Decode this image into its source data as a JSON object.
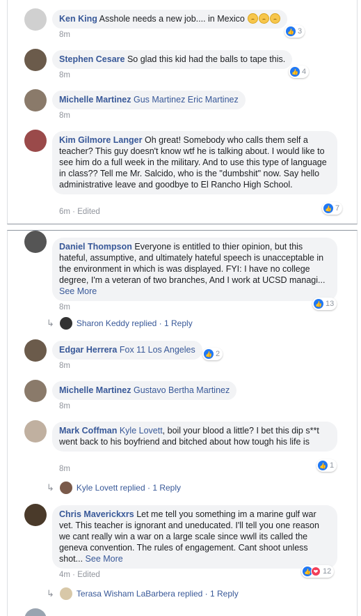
{
  "top_comments": [
    {
      "author": "Ken King",
      "text": "Asshole needs a new job.... in Mexico",
      "time": "8m",
      "reactions": "3",
      "emoji_icon": "tired-face-emoji",
      "avatar_color": "#c8c8c8"
    },
    {
      "author": "Stephen Cesare",
      "text": "So glad this kid had the balls to tape this.",
      "time": "8m",
      "reactions": "4",
      "avatar_color": "#5a4a3a"
    },
    {
      "author": "Michelle Martinez",
      "tags": "Gus Martinez Eric Martinez",
      "time": "8m",
      "avatar_color": "#7a6a5a"
    },
    {
      "author": "Kim Gilmore Langer",
      "text": "Oh great! Somebody who calls them self a teacher? This guy doesn't know wtf he is talking about. I would like to see him do a full week in the military. And to use this type of language in class?? Tell me Mr. Salcido, who is the \"dumbshit\" now. Say hello administrative leave and goodbye to El Rancho High School.",
      "time": "6m · Edited",
      "reactions": "7",
      "avatar_color": "#8a3a3a"
    }
  ],
  "bottom_comments": [
    {
      "author": "Daniel Thompson",
      "text": "Everyone is entitled to thier opinion, but this hateful, assumptive, and ultimately hateful speech is unacceptable in the environment in which is was displayed. FYI: I have no college degree, I'm a veteran of two branches, And I work at UCSD managi...",
      "see_more": "See More",
      "time": "8m",
      "reactions": "13",
      "avatar_color": "#4a4a4a",
      "reply": {
        "name": "Sharon Keddy",
        "text": "replied · 1 Reply"
      }
    },
    {
      "author": "Edgar Herrera",
      "tags": "Fox 11 Los Angeles",
      "time": "8m",
      "reactions": "2",
      "avatar_color": "#5a4a3a"
    },
    {
      "author": "Michelle Martinez",
      "tags": "Gustavo Bertha Martinez",
      "time": "8m",
      "avatar_color": "#7a6a5a"
    },
    {
      "author": "Mark Coffman",
      "tags": "Kyle Lovett",
      "text": ", boil your blood a little? I bet this dip s**t went back to his boyfriend and bitched about how tough his life is",
      "time": "8m",
      "reactions": "1",
      "avatar_color": "#b0a090",
      "reply": {
        "name": "Kyle Lovett",
        "text": "replied · 1 Reply"
      }
    },
    {
      "author": "Chris Maverickxrs",
      "text": "Let me tell you something im a marine gulf war vet. This teacher is ignorant and uneducated. I'll tell you one reason we cant really win a war on a large scale since wwll its called the geneva convention. The rules of engagement. Cant shoot unless shot...",
      "see_more": "See More",
      "time": "4m · Edited",
      "reactions": "12",
      "avatar_color": "#3a2a1a",
      "reply": {
        "name": "Terasa Wisham LaBarbera",
        "text": "replied · 1 Reply"
      }
    }
  ],
  "colors": {
    "link": "#385898",
    "bubble": "#f2f3f5",
    "like": "#2078f4",
    "love": "#f33e58",
    "meta": "#90949c"
  }
}
